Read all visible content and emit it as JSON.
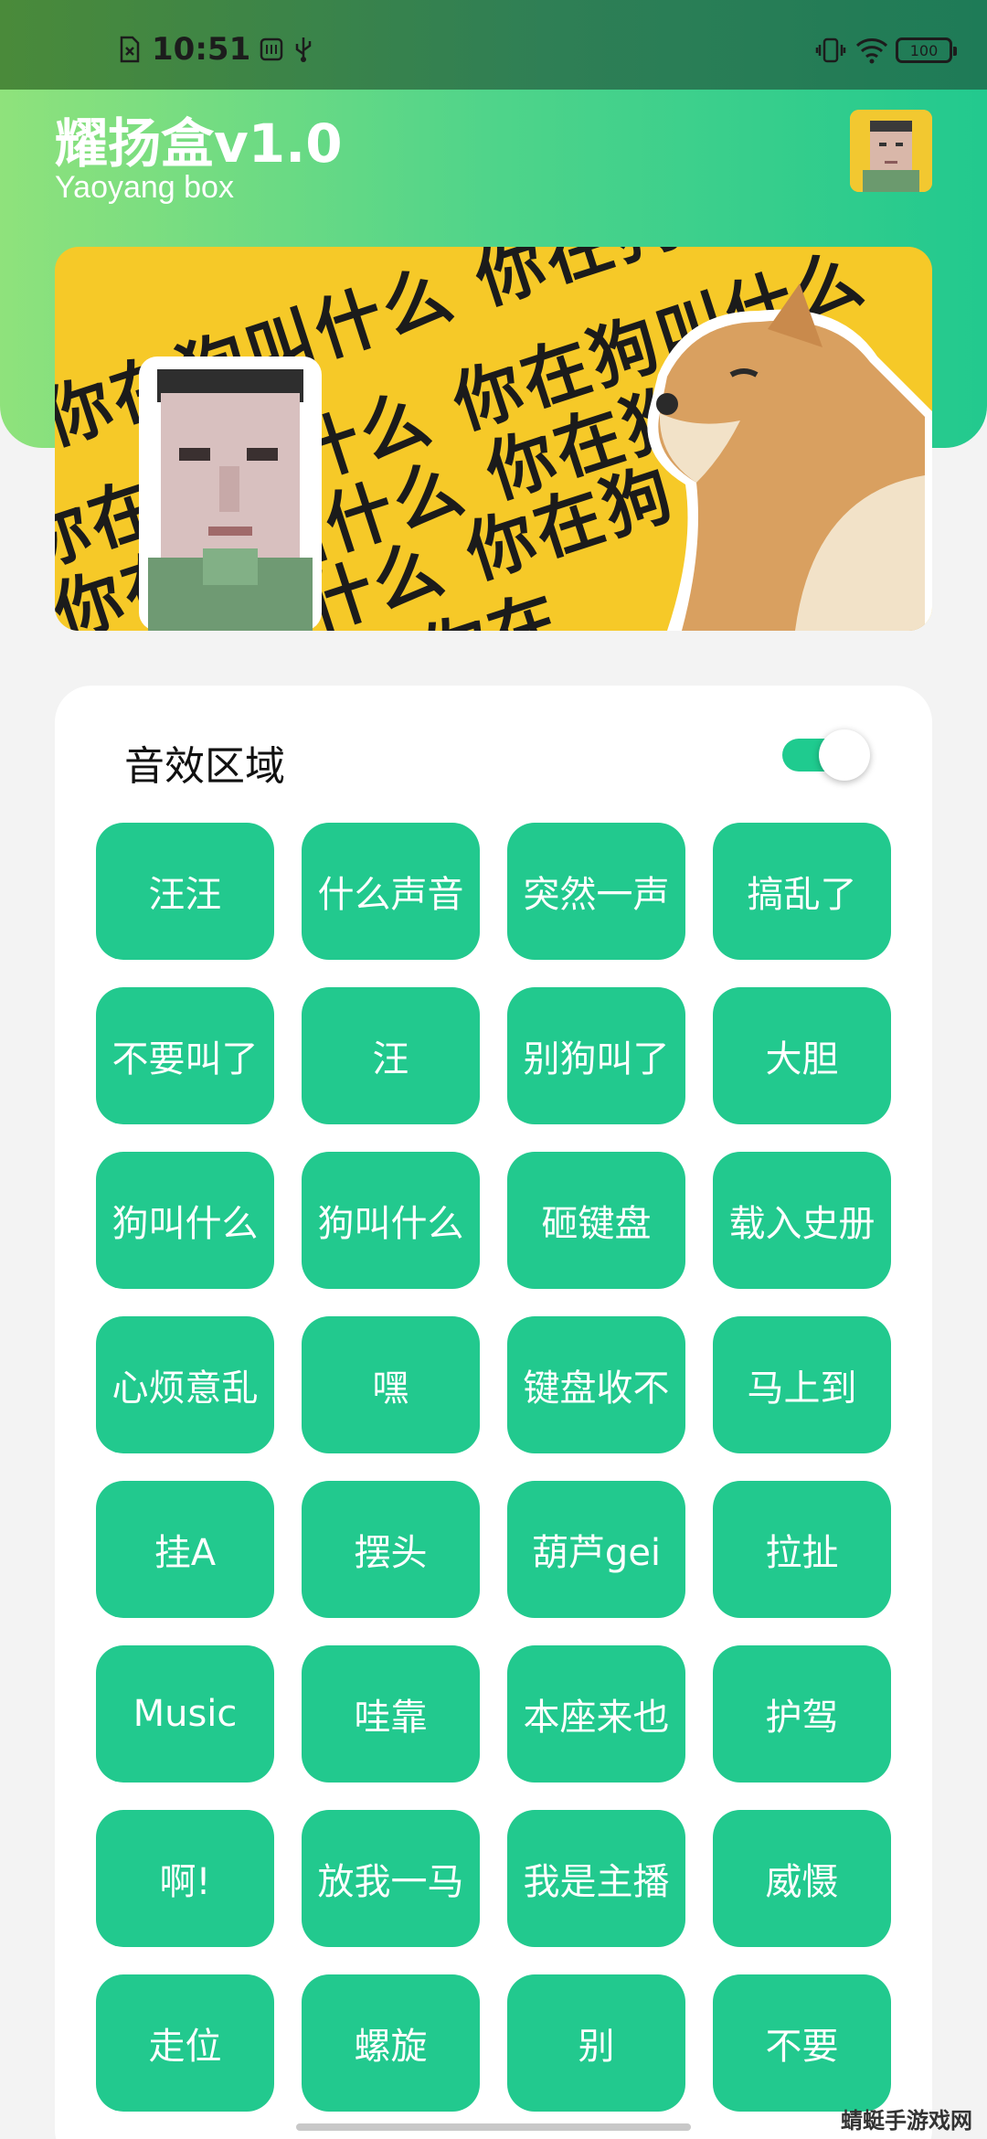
{
  "status_bar": {
    "time": "10:51",
    "battery": "100",
    "icons": [
      "sim-icon",
      "usb-icon",
      "vibrate-icon",
      "wifi-icon",
      "battery-icon"
    ]
  },
  "header": {
    "title": "耀扬盒v1.0",
    "subtitle": "Yaoyang box"
  },
  "banner": {
    "text_lines": [
      "你在狗叫什么 你在狗",
      "你在狗叫什么 你在狗叫什么",
      "你在狗叫什么 你在狗叫",
      "你在狗叫什么 你在狗",
      "叫什么 你在"
    ]
  },
  "sound_panel": {
    "title": "音效区域",
    "toggle_on": true,
    "buttons": [
      "汪汪",
      "什么声音",
      "突然一声",
      "搞乱了",
      "不要叫了",
      "汪",
      "别狗叫了",
      "大胆",
      "狗叫什么",
      "狗叫什么",
      "砸键盘",
      "载入史册",
      "心烦意乱",
      "嘿",
      "键盘收不",
      "马上到",
      "挂A",
      "摆头",
      "葫芦gei",
      "拉扯",
      "Music",
      "哇靠",
      "本座来也",
      "护驾",
      "啊!",
      "放我一马",
      "我是主播",
      "威慑",
      "走位",
      "螺旋",
      "别",
      "不要"
    ]
  },
  "watermark": "蜻蜓手游戏网",
  "colors": {
    "accent": "#22c98e",
    "banner_yellow": "#f6c928"
  }
}
